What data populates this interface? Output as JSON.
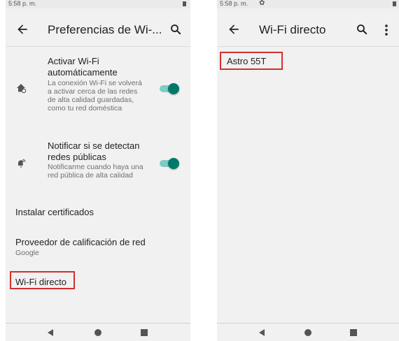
{
  "left_screen": {
    "status": {
      "time": "5:58 p. m."
    },
    "appbar": {
      "title": "Preferencias de Wi-..."
    },
    "prefs": [
      {
        "title": "Activar Wi-Fi automáticamente",
        "summary": "La conexión Wi-Fi se volverá a activar cerca de las redes de alta calidad guardadas, como tu red doméstica",
        "enabled": true
      },
      {
        "title": "Notificar si se detectan redes públicas",
        "summary": "Notificarme cuando haya una red pública de alta calidad",
        "enabled": true
      }
    ],
    "install_certs": "Instalar certificados",
    "rating_provider": {
      "title": "Proveedor de calificación de red",
      "value": "Google"
    },
    "wifi_direct": "Wi-Fi directo"
  },
  "right_screen": {
    "status": {
      "time": "5:58 p. m."
    },
    "appbar": {
      "title": "Wi-Fi directo"
    },
    "devices": [
      "Astro 55T"
    ]
  },
  "colors": {
    "accent": "#00796b",
    "accent_track": "#80cbc4",
    "highlight": "#d32f2f"
  },
  "icons": [
    "back-arrow-icon",
    "search-icon",
    "more-vert-icon",
    "wifi-auto-icon",
    "wifi-notify-icon",
    "gear-icon",
    "battery-icon"
  ]
}
